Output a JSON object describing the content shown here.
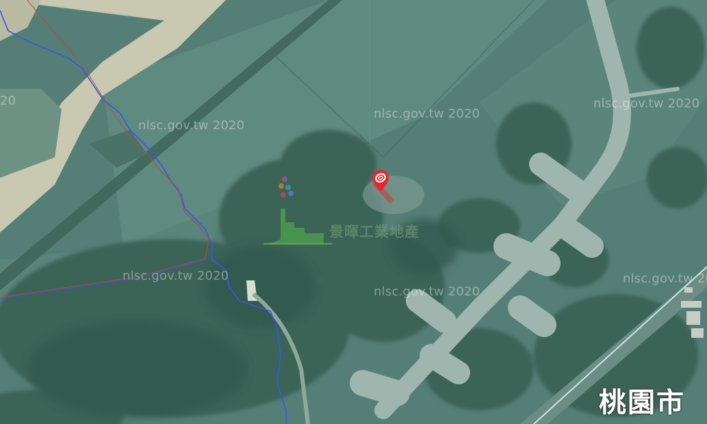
{
  "watermark": {
    "text": "nlsc.gov.tw 2020",
    "fragment": "20"
  },
  "region_label": "桃園市",
  "park_label": "景暉工業地產",
  "marker": {
    "icon": "map-pin-icon",
    "color": "#e0292f"
  },
  "colors": {
    "river": "#3a55e6",
    "boundary": "#b84a3a",
    "grass": "#4f7a72",
    "forest": "#3b6659",
    "runway": "#9bb3ab"
  }
}
